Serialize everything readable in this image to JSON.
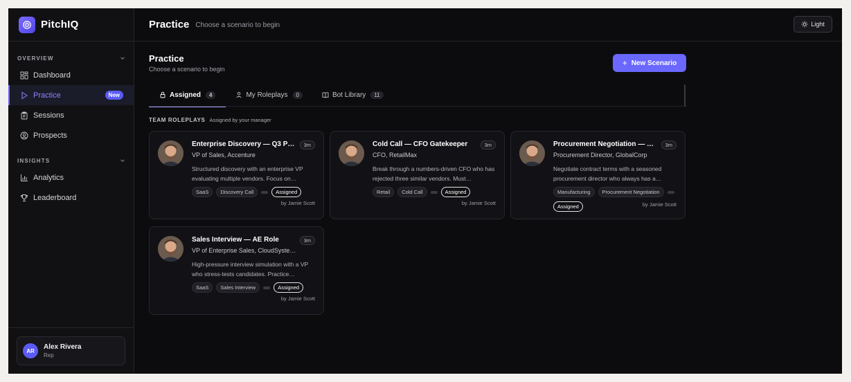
{
  "brand": {
    "name": "PitchIQ"
  },
  "sidebar": {
    "overview_title": "OVERVIEW",
    "insights_title": "INSIGHTS",
    "items": [
      {
        "label": "Dashboard"
      },
      {
        "label": "Practice",
        "badge": "New"
      },
      {
        "label": "Sessions"
      },
      {
        "label": "Prospects"
      },
      {
        "label": "Analytics"
      },
      {
        "label": "Leaderboard"
      }
    ],
    "user": {
      "initials": "AR",
      "name": "Alex Rivera",
      "role": "Rep"
    }
  },
  "topbar": {
    "title": "Practice",
    "subtitle": "Choose a scenario to begin",
    "theme_label": "Light"
  },
  "page": {
    "title": "Practice",
    "subtitle": "Choose a scenario to begin",
    "new_button": "New Scenario",
    "tabs": [
      {
        "label": "Assigned",
        "count": "4"
      },
      {
        "label": "My Roleplays",
        "count": "0"
      },
      {
        "label": "Bot Library",
        "count": "11"
      }
    ],
    "group_title": "TEAM ROLEPLAYS",
    "group_sub": "Assigned by your manager"
  },
  "cards": [
    {
      "title": "Enterprise Discovery — Q3 Pu…",
      "duration": "3m",
      "role": "VP of Sales, Accenture",
      "desc": "Structured discovery with an enterprise VP evaluating multiple vendors. Focus on…",
      "tags": [
        "SaaS",
        "Discovery Call"
      ],
      "status": "Assigned",
      "by": "by Jamie Scott"
    },
    {
      "title": "Cold Call — CFO Gatekeeper",
      "duration": "3m",
      "role": "CFO, RetailMax",
      "desc": "Break through a numbers-driven CFO who has rejected three similar vendors. Must…",
      "tags": [
        "Retail",
        "Cold Call"
      ],
      "status": "Assigned",
      "by": "by Jamie Scott"
    },
    {
      "title": "Procurement Negotiation — M…",
      "duration": "3m",
      "role": "Procurement Director, GlobalCorp",
      "desc": "Negotiate contract terms with a seasoned procurement director who always has a…",
      "tags": [
        "Manufacturing",
        "Procurement Negotiation"
      ],
      "status": "Assigned",
      "by": "by Jamie Scott"
    },
    {
      "title": "Sales Interview — AE Role",
      "duration": "3m",
      "role": "VP of Enterprise Sales, CloudSyste…",
      "desc": "High-pressure interview simulation with a VP who stress-tests candidates. Practice…",
      "tags": [
        "SaaS",
        "Sales Interview"
      ],
      "status": "Assigned",
      "by": "by Jamie Scott"
    }
  ],
  "colors": {
    "accent": "#6a68ff",
    "background": "#0c0c0f",
    "sidebar": "#111114"
  }
}
